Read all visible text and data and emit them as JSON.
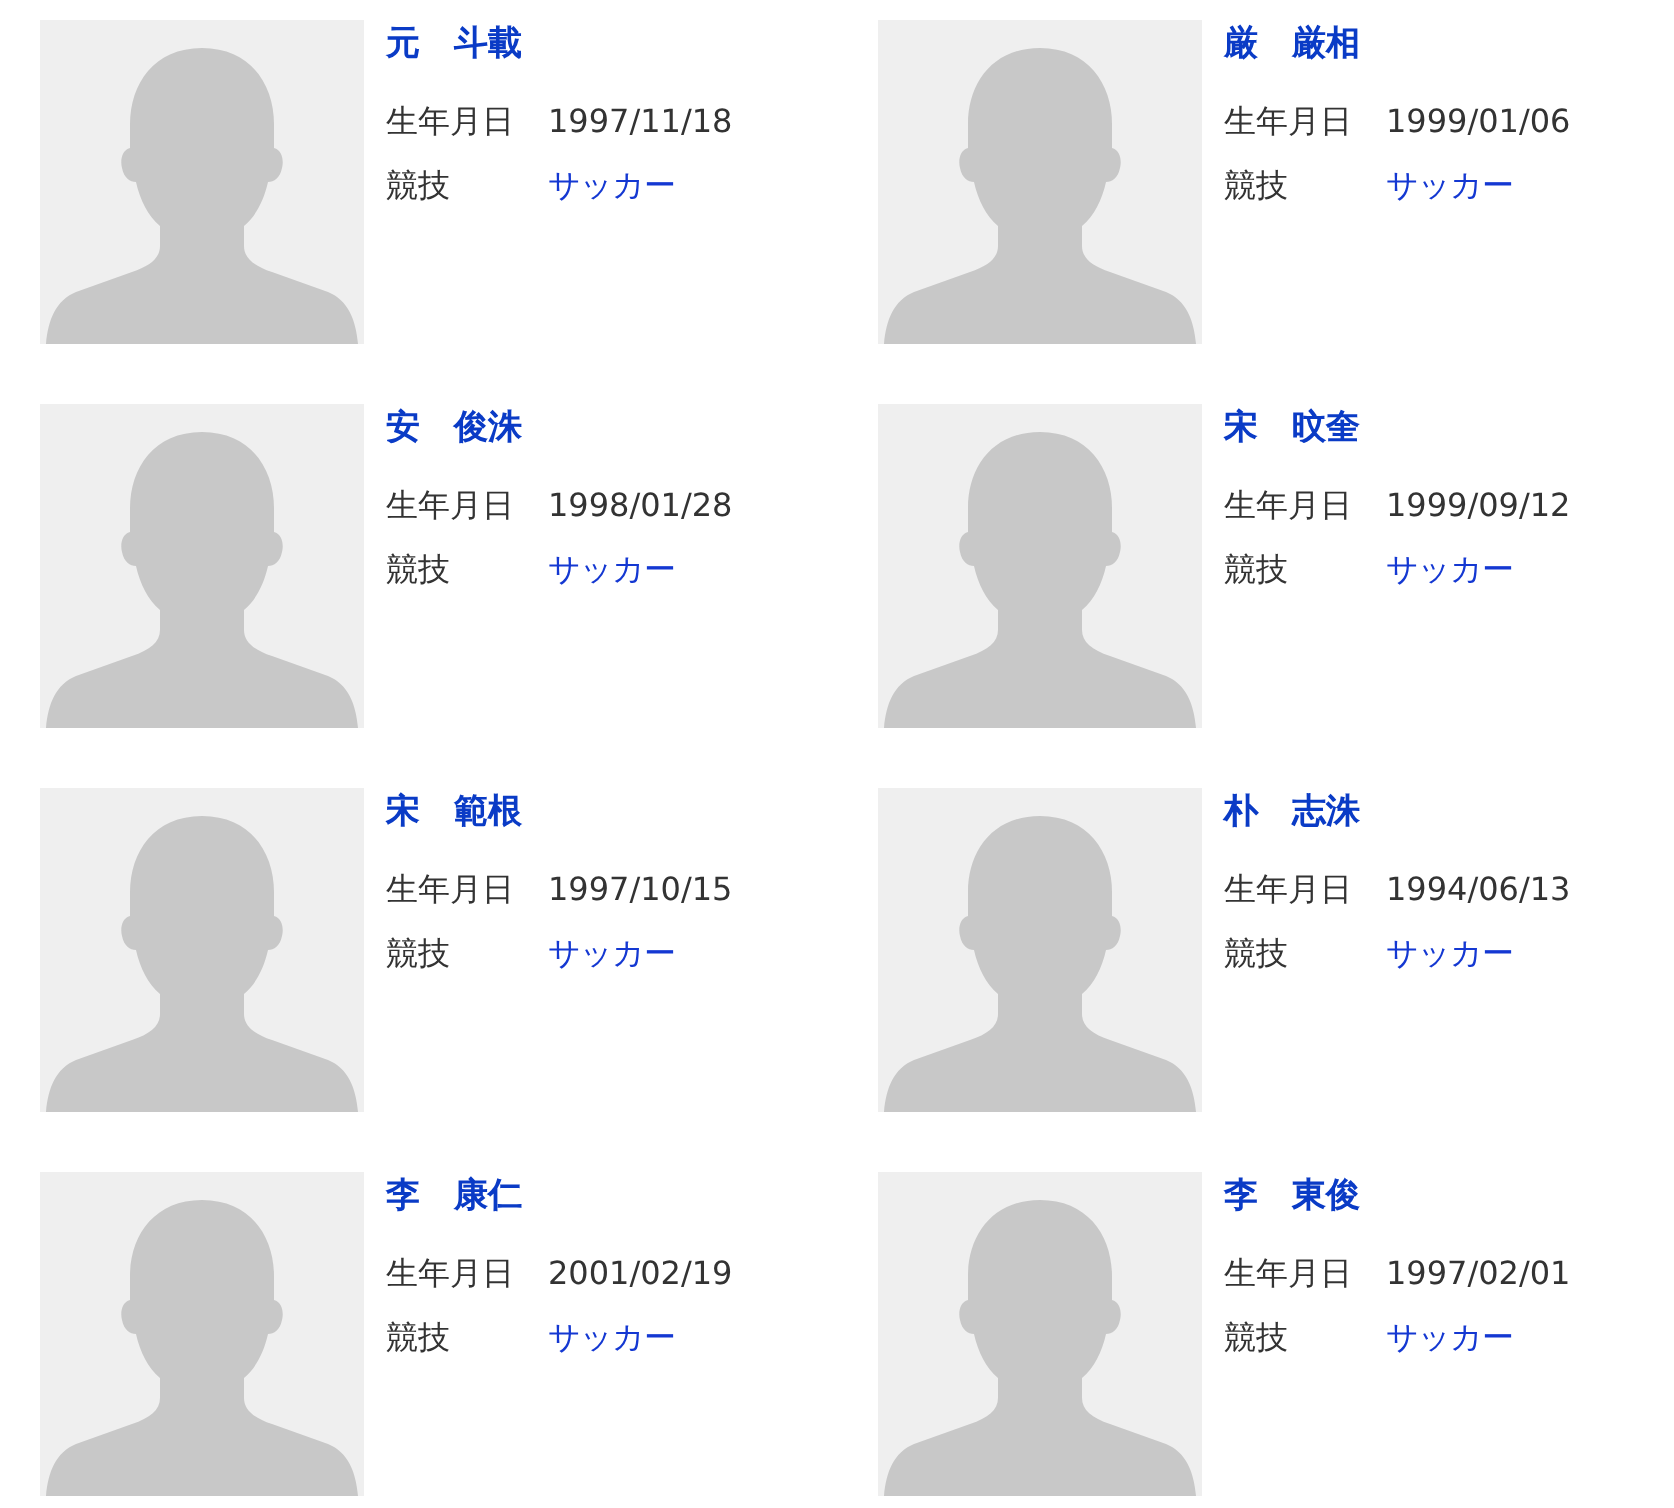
{
  "players": [
    {
      "name": "元　斗載",
      "birth_label": "生年月日",
      "birth_date": "1997/11/18",
      "sport_label": "競技",
      "sport": "サッカー"
    },
    {
      "name": "厳　厳相",
      "birth_label": "生年月日",
      "birth_date": "1999/01/06",
      "sport_label": "競技",
      "sport": "サッカー"
    },
    {
      "name": "安　俊洙",
      "birth_label": "生年月日",
      "birth_date": "1998/01/28",
      "sport_label": "競技",
      "sport": "サッカー"
    },
    {
      "name": "宋　旼奎",
      "birth_label": "生年月日",
      "birth_date": "1999/09/12",
      "sport_label": "競技",
      "sport": "サッカー"
    },
    {
      "name": "宋　範根",
      "birth_label": "生年月日",
      "birth_date": "1997/10/15",
      "sport_label": "競技",
      "sport": "サッカー"
    },
    {
      "name": "朴　志洙",
      "birth_label": "生年月日",
      "birth_date": "1994/06/13",
      "sport_label": "競技",
      "sport": "サッカー"
    },
    {
      "name": "李　康仁",
      "birth_label": "生年月日",
      "birth_date": "2001/02/19",
      "sport_label": "競技",
      "sport": "サッカー"
    },
    {
      "name": "李　東俊",
      "birth_label": "生年月日",
      "birth_date": "1997/02/01",
      "sport_label": "競技",
      "sport": "サッカー"
    }
  ]
}
